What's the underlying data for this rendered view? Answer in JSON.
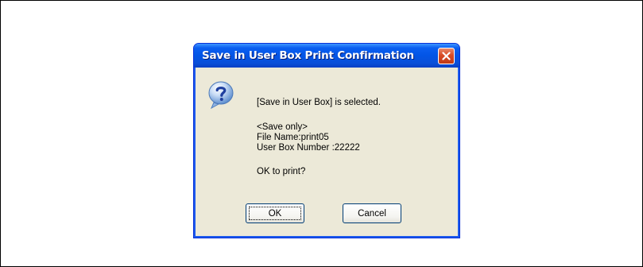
{
  "dialog": {
    "title": "Save in User Box Print Confirmation",
    "messages": {
      "selected": "[Save in User Box] is selected.",
      "mode": "<Save only>",
      "file_name": "File Name:print05",
      "box_number": "User Box Number :22222",
      "question": "OK to print?"
    },
    "buttons": {
      "ok_label": "OK",
      "cancel_label": "Cancel"
    }
  },
  "icons": {
    "title_close": "close-icon",
    "message": "question-icon"
  },
  "colors": {
    "titlebar": "#0355e6",
    "dialog_background": "#ece9d8",
    "close_button": "#d84b26"
  }
}
